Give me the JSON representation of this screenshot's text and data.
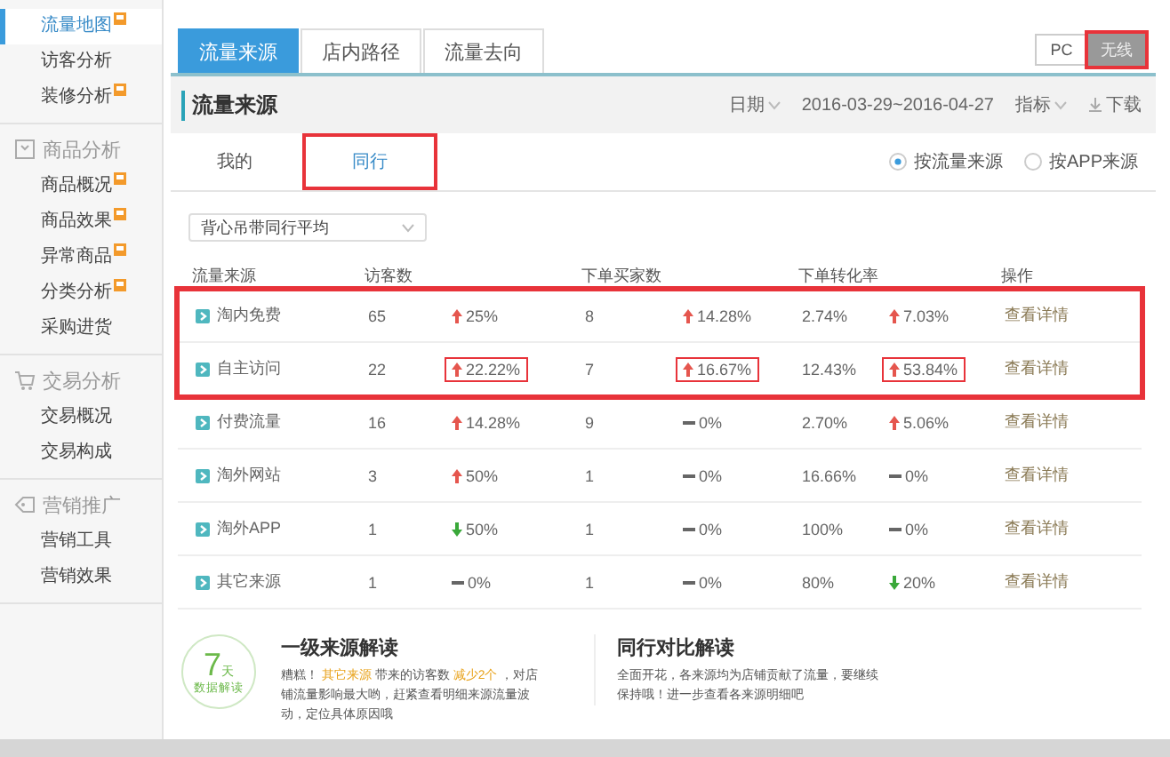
{
  "sidebar": {
    "groups": [
      {
        "items": [
          {
            "label": "流量地图",
            "selected": true,
            "badge": true
          },
          {
            "label": "访客分析",
            "selected": false,
            "badge": false
          },
          {
            "label": "装修分析",
            "selected": false,
            "badge": true
          }
        ]
      },
      {
        "title": "商品分析",
        "items": [
          {
            "label": "商品概况",
            "selected": false,
            "badge": true
          },
          {
            "label": "商品效果",
            "selected": false,
            "badge": true
          },
          {
            "label": "异常商品",
            "selected": false,
            "badge": true
          },
          {
            "label": "分类分析",
            "selected": false,
            "badge": true
          },
          {
            "label": "采购进货",
            "selected": false,
            "badge": false
          }
        ]
      },
      {
        "title": "交易分析",
        "items": [
          {
            "label": "交易概况",
            "selected": false,
            "badge": false
          },
          {
            "label": "交易构成",
            "selected": false,
            "badge": false
          }
        ]
      },
      {
        "title": "营销推广",
        "items": [
          {
            "label": "营销工具",
            "selected": false,
            "badge": false
          },
          {
            "label": "营销效果",
            "selected": false,
            "badge": false
          }
        ]
      }
    ]
  },
  "tabs": [
    {
      "label": "流量来源",
      "selected": true
    },
    {
      "label": "店内路径",
      "selected": false
    },
    {
      "label": "流量去向",
      "selected": false
    }
  ],
  "devices": [
    {
      "label": "PC",
      "selected": false,
      "annotated": false
    },
    {
      "label": "无线",
      "selected": true,
      "annotated": true
    }
  ],
  "section": {
    "title": "流量来源",
    "date_label": "日期",
    "date_range": "2016-03-29~2016-04-27",
    "metric_label": "指标",
    "download": "下载"
  },
  "subtabs": [
    {
      "label": "我的",
      "selected": false,
      "annotated": false
    },
    {
      "label": "同行",
      "selected": true,
      "annotated": true
    }
  ],
  "radios": [
    {
      "label": "按流量来源",
      "selected": true
    },
    {
      "label": "按APP来源",
      "selected": false
    }
  ],
  "peer_select": {
    "value": "背心吊带同行平均"
  },
  "table": {
    "columns": [
      "流量来源",
      "访客数",
      "下单买家数",
      "下单转化率",
      "操作"
    ],
    "rows": [
      {
        "highlighted": true,
        "source": "淘内免费",
        "visitors": "65",
        "visitors_change": {
          "kind": "up",
          "text": "25%",
          "annotated": false
        },
        "buyers": "8",
        "buyers_change": {
          "kind": "up",
          "text": "14.28%",
          "annotated": false
        },
        "rate": "2.74%",
        "rate_change": {
          "kind": "up",
          "text": "7.03%",
          "annotated": false
        },
        "action": "查看详情"
      },
      {
        "highlighted": true,
        "source": "自主访问",
        "visitors": "22",
        "visitors_change": {
          "kind": "up",
          "text": "22.22%",
          "annotated": true
        },
        "buyers": "7",
        "buyers_change": {
          "kind": "up",
          "text": "16.67%",
          "annotated": true
        },
        "rate": "12.43%",
        "rate_change": {
          "kind": "up",
          "text": "53.84%",
          "annotated": true
        },
        "action": "查看详情"
      },
      {
        "highlighted": false,
        "source": "付费流量",
        "visitors": "16",
        "visitors_change": {
          "kind": "up",
          "text": "14.28%",
          "annotated": false
        },
        "buyers": "9",
        "buyers_change": {
          "kind": "flat",
          "text": "0%",
          "annotated": false
        },
        "rate": "2.70%",
        "rate_change": {
          "kind": "up",
          "text": "5.06%",
          "annotated": false
        },
        "action": "查看详情"
      },
      {
        "highlighted": false,
        "source": "淘外网站",
        "visitors": "3",
        "visitors_change": {
          "kind": "up",
          "text": "50%",
          "annotated": false
        },
        "buyers": "1",
        "buyers_change": {
          "kind": "flat",
          "text": "0%",
          "annotated": false
        },
        "rate": "16.66%",
        "rate_change": {
          "kind": "flat",
          "text": "0%",
          "annotated": false
        },
        "action": "查看详情"
      },
      {
        "highlighted": false,
        "source": "淘外APP",
        "visitors": "1",
        "visitors_change": {
          "kind": "down",
          "text": "50%",
          "annotated": false
        },
        "buyers": "1",
        "buyers_change": {
          "kind": "flat",
          "text": "0%",
          "annotated": false
        },
        "rate": "100%",
        "rate_change": {
          "kind": "flat",
          "text": "0%",
          "annotated": false
        },
        "action": "查看详情"
      },
      {
        "highlighted": false,
        "source": "其它来源",
        "visitors": "1",
        "visitors_change": {
          "kind": "flat",
          "text": "0%",
          "annotated": false
        },
        "buyers": "1",
        "buyers_change": {
          "kind": "flat",
          "text": "0%",
          "annotated": false
        },
        "rate": "80%",
        "rate_change": {
          "kind": "down",
          "text": "20%",
          "annotated": false
        },
        "action": "查看详情"
      }
    ]
  },
  "insight": {
    "badge_number": "7",
    "badge_unit": "天",
    "badge_caption": "数据解读",
    "cards": [
      {
        "title": "一级来源解读",
        "segments": [
          {
            "text": "糟糕！ ",
            "accent": false
          },
          {
            "text": "其它来源",
            "accent": true
          },
          {
            "text": " 带来的访客数 ",
            "accent": false
          },
          {
            "text": "减少2个",
            "accent": true
          },
          {
            "text": " ，对店铺流量影响最大哟，赶紧查看明细来源流量波动，定位具体原因哦",
            "accent": false
          }
        ]
      },
      {
        "title": "同行对比解读",
        "segments": [
          {
            "text": "全面开花，各来源均为店铺贡献了流量，要继续保持哦！进一步查看各来源明细吧",
            "accent": false
          }
        ]
      }
    ]
  }
}
